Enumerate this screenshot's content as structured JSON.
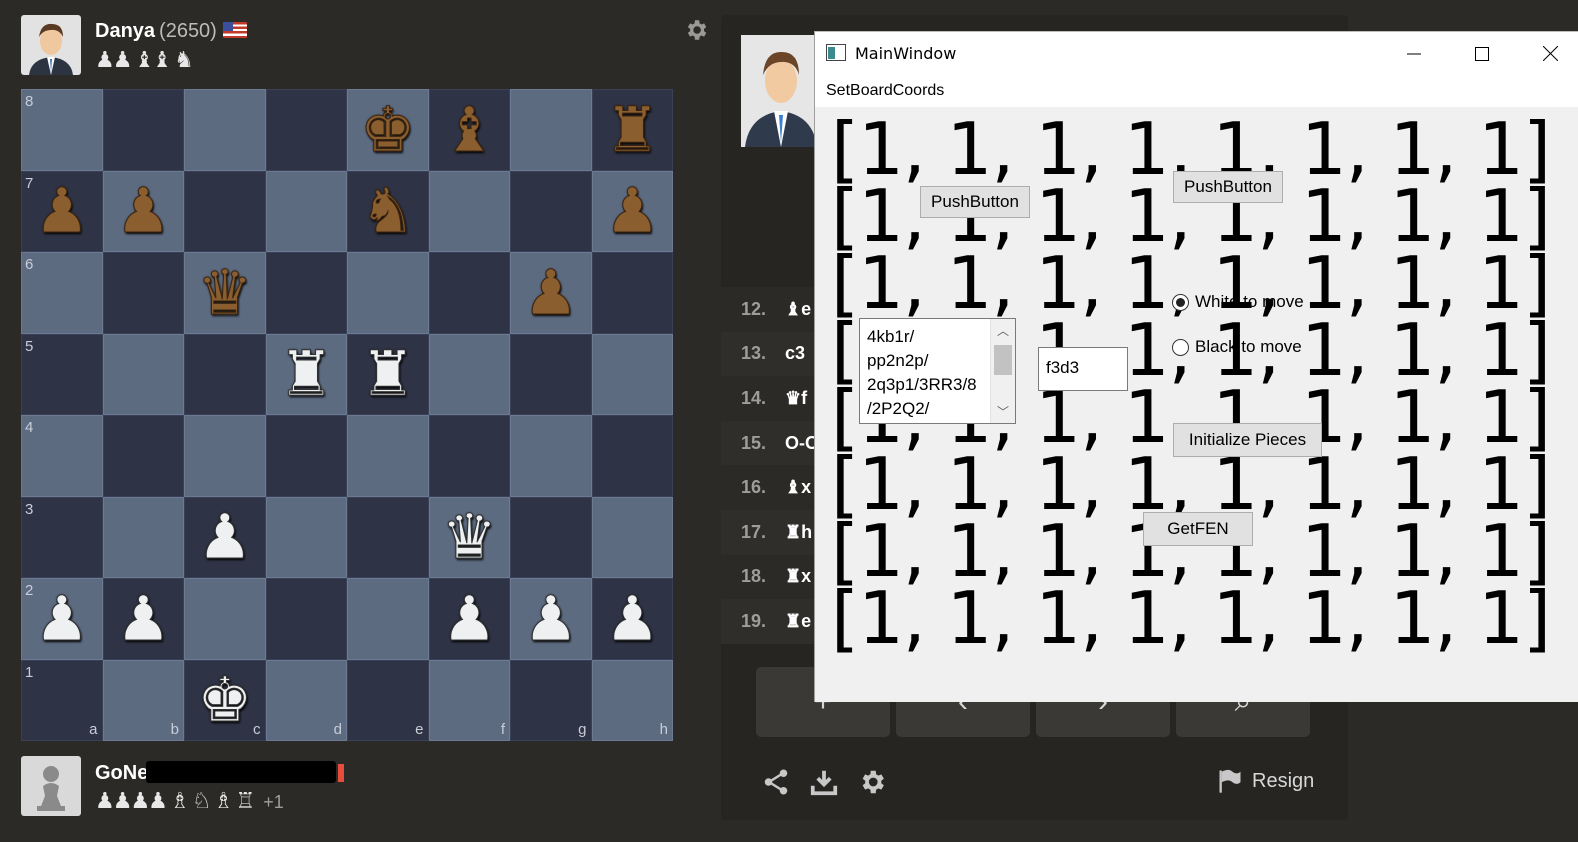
{
  "top_player": {
    "name": "Danya",
    "rating": "(2650)",
    "captured": "♟♟ ♝♝ ♞"
  },
  "bottom_player": {
    "name": "GoNe",
    "captured": "♟♟♟♟ ♗ ♘ ♗ ♖",
    "extra": "+1"
  },
  "board": {
    "ranks": [
      "8",
      "7",
      "6",
      "5",
      "4",
      "3",
      "2",
      "1"
    ],
    "files": [
      "a",
      "b",
      "c",
      "d",
      "e",
      "f",
      "g",
      "h"
    ],
    "position": [
      [
        "",
        "",
        "",
        "",
        "bK",
        "bB",
        "",
        "bR"
      ],
      [
        "bP",
        "bP",
        "",
        "",
        "bN",
        "",
        "",
        "bP"
      ],
      [
        "",
        "",
        "bQ",
        "",
        "",
        "",
        "bP",
        ""
      ],
      [
        "",
        "",
        "",
        "wR",
        "wR",
        "",
        "",
        ""
      ],
      [
        "",
        "",
        "",
        "",
        "",
        "",
        "",
        ""
      ],
      [
        "",
        "",
        "wP",
        "",
        "",
        "wQ",
        "",
        ""
      ],
      [
        "wP",
        "wP",
        "",
        "",
        "",
        "wP",
        "wP",
        "wP"
      ],
      [
        "",
        "",
        "wK",
        "",
        "",
        "",
        "",
        ""
      ]
    ]
  },
  "moves": [
    {
      "num": "12.",
      "san": "♝e"
    },
    {
      "num": "13.",
      "san": "c3"
    },
    {
      "num": "14.",
      "san": "♛f"
    },
    {
      "num": "15.",
      "san": "O-O"
    },
    {
      "num": "16.",
      "san": "♝x"
    },
    {
      "num": "17.",
      "san": "♜h"
    },
    {
      "num": "18.",
      "san": "♜x"
    },
    {
      "num": "19.",
      "san": "♜e"
    }
  ],
  "controls": [
    "+",
    "‹",
    "›",
    "⌕"
  ],
  "resign_label": "Resign",
  "qt_window": {
    "title": "MainWindow",
    "menu": "SetBoardCoords",
    "grid_rows": [
      "[1, 1, 1, 1, 1, 1, 1, 1]",
      "[1, 1, 1, 1, 1, 1, 1, 1]",
      "[1, 1, 1, 1, 1, 1, 1, 1]",
      "[1, 1, 1, 1, 1, 1, 1, 1]",
      "[1, 1, 1, 1, 1, 1, 1, 1]",
      "[1, 1, 1, 1, 1, 1, 1, 1]",
      "[1, 1, 1, 1, 1, 1, 1, 1]",
      "[1, 1, 1, 1, 1, 1, 1, 1]"
    ],
    "push_button_1": "PushButton",
    "push_button_2": "PushButton",
    "radio_white": "White to move",
    "radio_black": "Black to move",
    "radio_selected": "white",
    "fen_text": "4kb1r/\npp2n2p/\n2q3p1/3RR3/8\n/2P2Q2/",
    "move_input": "f3d3",
    "init_button": "Initialize Pieces",
    "getfen_button": "GetFEN"
  },
  "colors": {
    "light_square": "#5d6b81",
    "dark_square": "#2e3345",
    "background": "#2b2a27"
  }
}
